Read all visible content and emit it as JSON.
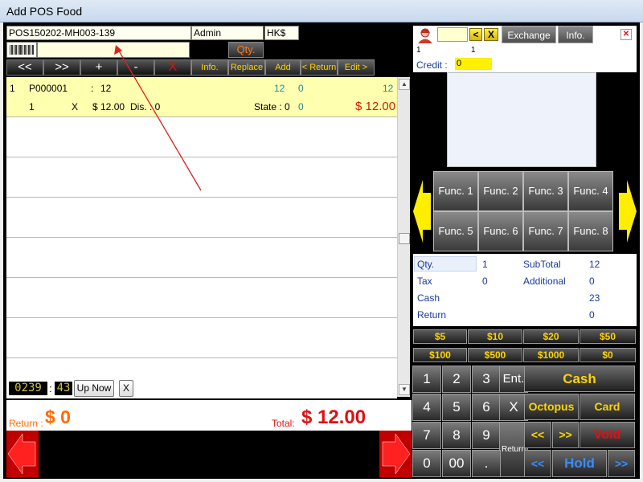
{
  "window": {
    "title": "Add POS Food"
  },
  "header": {
    "invoice_no": "POS150202-MH003-139",
    "user": "Admin",
    "currency": "HK$",
    "qty_label": "Qty.",
    "barcode_value": ""
  },
  "toolbar": {
    "prev_label": "<<",
    "next_label": ">>",
    "plus_label": "+",
    "minus_label": "-",
    "delete_label": "X",
    "info_label": "Info.",
    "replace_label": "Replace",
    "add_label": "Add",
    "return_label": "< Return",
    "edit_label": "Edit >"
  },
  "items": [
    {
      "index": "1",
      "code": "P000001",
      "sep": ":",
      "name": "12",
      "v1": "12",
      "v2": "0",
      "v3": "12",
      "qty": "1",
      "x": "X",
      "price": "$ 12.00",
      "dis": "Dis. : 0",
      "state": "State : 0",
      "s2": "0",
      "amount": "$ 12.00"
    }
  ],
  "list_footer": {
    "time_h": "0239",
    "time_sep": ":",
    "time_m": "43",
    "up_now_label": "Up Now",
    "clear_label": "X"
  },
  "totals": {
    "return_label": "Return :",
    "return_value": "$ 0",
    "total_label": "Total:",
    "total_value": "$ 12.00"
  },
  "customer": {
    "code_value": "",
    "prev_label": "<",
    "clear_label": "X",
    "exchange_label": "Exchange",
    "info_label": "Info.",
    "close_label": "✕",
    "val1": "1",
    "val2": "1",
    "credit_label": "Credit :",
    "credit_value": "0"
  },
  "functions": [
    "Func. 1",
    "Func. 2",
    "Func. 3",
    "Func. 4",
    "Func. 5",
    "Func. 6",
    "Func. 7",
    "Func. 8"
  ],
  "summary": {
    "qty_label": "Qty.",
    "qty_value": "1",
    "subtotal_label": "SubTotal",
    "subtotal_value": "12",
    "tax_label": "Tax",
    "tax_value": "0",
    "additional_label": "Additional",
    "additional_value": "0",
    "cash_label": "Cash",
    "cash_value": "23",
    "return_label": "Return",
    "return_value": "0"
  },
  "quick_cash": [
    "$5",
    "$10",
    "$20",
    "$50",
    "$100",
    "$500",
    "$1000",
    "$0"
  ],
  "keypad": {
    "k1": "1",
    "k2": "2",
    "k3": "3",
    "ent": "Ent.",
    "k4": "4",
    "k5": "5",
    "k6": "6",
    "clear": "X",
    "k7": "7",
    "k8": "8",
    "k9": "9",
    "ret": "Return",
    "k0": "0",
    "k00": "00",
    "dot": "."
  },
  "actions": {
    "cash": "Cash",
    "octopus": "Octopus",
    "card": "Card",
    "prev": "<<",
    "next": ">>",
    "void": "Void",
    "hold_prev": "<<",
    "hold": "Hold",
    "hold_next": ">>"
  },
  "colors": {
    "accent_yellow": "#ffd400",
    "total_red": "#e01010",
    "return_orange": "#ff6a00",
    "hold_blue": "#3a8cff"
  }
}
